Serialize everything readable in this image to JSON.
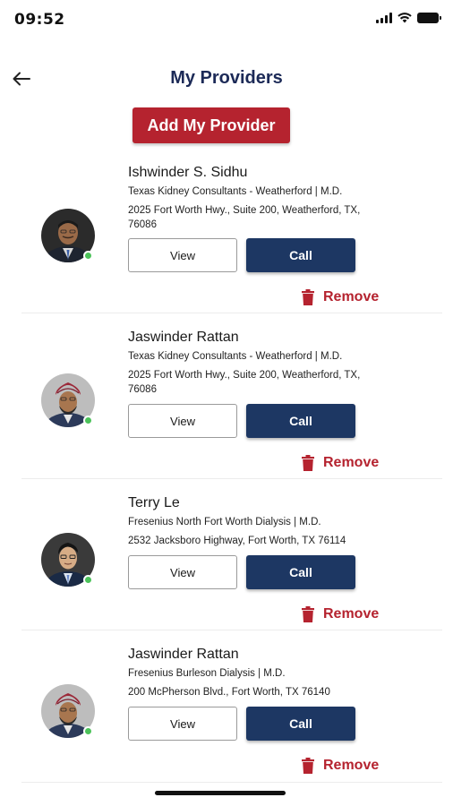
{
  "status_bar": {
    "time": "09:52"
  },
  "header": {
    "title": "My Providers",
    "back_icon": "arrow-left-icon"
  },
  "actions": {
    "add_provider_label": "Add My Provider"
  },
  "colors": {
    "brand_red": "#b5232f",
    "navy": "#1d3763",
    "title_navy": "#1c2a57",
    "online_green": "#4cc25a"
  },
  "providers": [
    {
      "name": "Ishwinder S. Sidhu",
      "organization": "Texas Kidney Consultants - Weatherford | M.D.",
      "address": "2025 Fort Worth Hwy., Suite 200, Weatherford, TX, 76086",
      "view_label": "View",
      "call_label": "Call",
      "remove_label": "Remove",
      "online": true
    },
    {
      "name": "Jaswinder Rattan",
      "organization": "Texas Kidney Consultants - Weatherford | M.D.",
      "address": "2025 Fort Worth Hwy., Suite 200, Weatherford, TX, 76086",
      "view_label": "View",
      "call_label": "Call",
      "remove_label": "Remove",
      "online": true
    },
    {
      "name": "Terry Le",
      "organization": "Fresenius North Fort Worth Dialysis | M.D.",
      "address": "2532 Jacksboro Highway, Fort Worth, TX 76114",
      "view_label": "View",
      "call_label": "Call",
      "remove_label": "Remove",
      "online": true
    },
    {
      "name": "Jaswinder Rattan",
      "organization": "Fresenius Burleson Dialysis | M.D.",
      "address": "200 McPherson Blvd., Fort Worth, TX 76140",
      "view_label": "View",
      "call_label": "Call",
      "remove_label": "Remove",
      "online": true
    }
  ]
}
